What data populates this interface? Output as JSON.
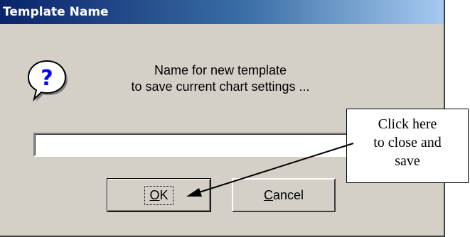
{
  "window": {
    "title": "Template Name"
  },
  "message": {
    "line1": "Name for new template",
    "line2": "to save current chart settings ..."
  },
  "name_input": {
    "value": "",
    "placeholder": ""
  },
  "buttons": {
    "ok": {
      "mnemonic": "O",
      "rest": "K"
    },
    "cancel": {
      "mnemonic": "C",
      "rest": "ancel"
    }
  },
  "callout": {
    "line1": "Click here",
    "line2": "to close and",
    "line3": "save"
  },
  "icons": {
    "question": "question-icon"
  },
  "colors": {
    "dialog_face": "#d4d0c8",
    "title_gradient_start": "#0a246a",
    "title_gradient_end": "#a6caf0",
    "icon_blue": "#0000ff"
  }
}
